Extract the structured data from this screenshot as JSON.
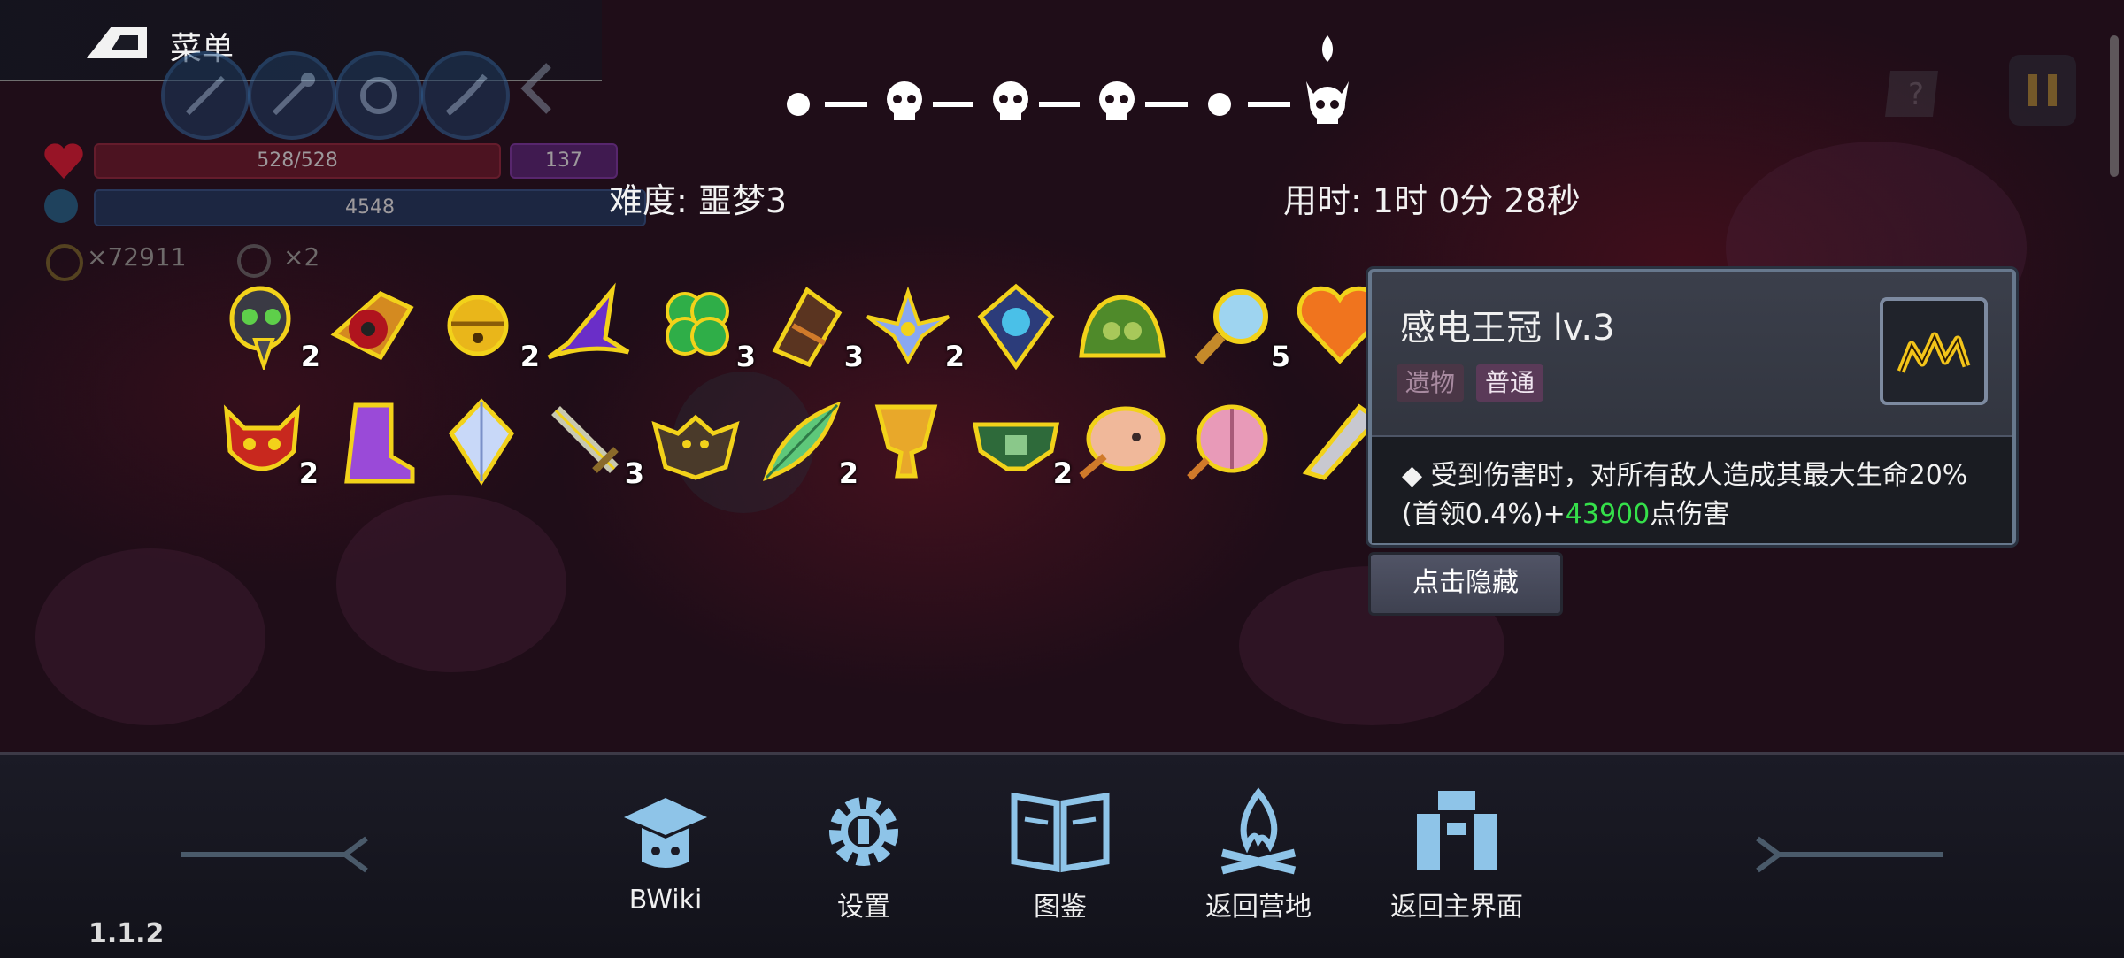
{
  "header": {
    "menu_label": "菜单",
    "menu_icon": "back-arrow-icon",
    "hp_text": "528/528",
    "shield_text": "137",
    "mp_text": "4548",
    "gold_text": "×72911",
    "keys_text": "×2"
  },
  "route": {
    "nodes": [
      "dot",
      "skull",
      "skull",
      "skull",
      "dot",
      "boss-skull"
    ],
    "current_index": 5
  },
  "status": {
    "difficulty": "难度: 噩梦3",
    "time": "用时: 1时 0分 28秒"
  },
  "inventory": {
    "row1": [
      {
        "icon": "plague-mask-icon",
        "count": "2"
      },
      {
        "icon": "red-eye-icon",
        "count": ""
      },
      {
        "icon": "golden-bell-icon",
        "count": "2"
      },
      {
        "icon": "wizard-hat-icon",
        "count": ""
      },
      {
        "icon": "four-leaf-clover-icon",
        "count": "3"
      },
      {
        "icon": "bracer-icon",
        "count": "3"
      },
      {
        "icon": "blue-lotus-icon",
        "count": "2"
      },
      {
        "icon": "crystal-orb-emblem-icon",
        "count": ""
      },
      {
        "icon": "green-helmet-icon",
        "count": ""
      },
      {
        "icon": "magnifier-icon",
        "count": "5"
      },
      {
        "icon": "orange-heart-icon",
        "count": ""
      }
    ],
    "row2": [
      {
        "icon": "demon-mask-icon",
        "count": "2"
      },
      {
        "icon": "purple-boot-icon",
        "count": ""
      },
      {
        "icon": "diamond-crest-icon",
        "count": ""
      },
      {
        "icon": "sword-icon",
        "count": "3"
      },
      {
        "icon": "bat-icon",
        "count": ""
      },
      {
        "icon": "feather-leaf-icon",
        "count": "2"
      },
      {
        "icon": "golden-chalice-icon",
        "count": ""
      },
      {
        "icon": "green-belt-icon",
        "count": "2"
      },
      {
        "icon": "pink-creature-icon",
        "count": ""
      },
      {
        "icon": "brain-icon",
        "count": ""
      },
      {
        "icon": "silver-blade-icon",
        "count": ""
      }
    ]
  },
  "tooltip": {
    "title": "感电王冠 lv.3",
    "tag1": "遗物",
    "tag2": "普通",
    "icon": "electric-crown-icon",
    "line1": "◆ 受到伤害时，对所有敌人造成其最大生命20%",
    "line2_prefix": "(首领0.4%)+",
    "line2_value": "43900",
    "line2_suffix": "点伤害",
    "hide_button": "点击隐藏"
  },
  "bottom_nav": [
    {
      "label": "BWiki",
      "icon": "graduation-cap-icon"
    },
    {
      "label": "设置",
      "icon": "gear-icon"
    },
    {
      "label": "图鉴",
      "icon": "book-icon"
    },
    {
      "label": "返回营地",
      "icon": "campfire-icon"
    },
    {
      "label": "返回主界面",
      "icon": "gate-icon"
    }
  ],
  "version": "1.1.2",
  "colors": {
    "accent_green": "#35e04a",
    "item_outline": "#f2d21a",
    "background": "#1f0d18"
  }
}
